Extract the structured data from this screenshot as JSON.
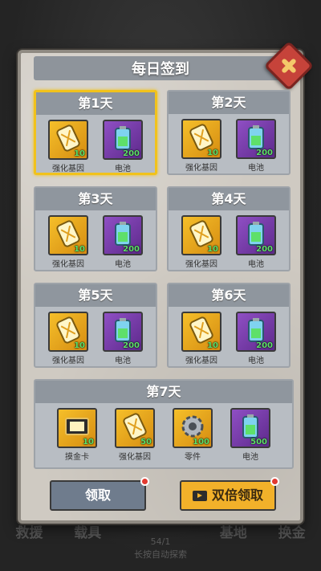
{
  "background": {
    "nav": [
      "救援",
      "载具",
      "基地",
      "换金"
    ],
    "center_count": "54/1",
    "center_hint": "长按自动探索"
  },
  "dialog": {
    "title": "每日签到",
    "days": [
      {
        "label": "第1天",
        "highlight": true,
        "rewards": [
          {
            "name": "强化基因",
            "qty": "10",
            "icon": "gene-icon",
            "color": "gold"
          },
          {
            "name": "电池",
            "qty": "200",
            "icon": "battery-icon",
            "color": "purple"
          }
        ]
      },
      {
        "label": "第2天",
        "highlight": false,
        "rewards": [
          {
            "name": "强化基因",
            "qty": "10",
            "icon": "gene-icon",
            "color": "gold"
          },
          {
            "name": "电池",
            "qty": "200",
            "icon": "battery-icon",
            "color": "purple"
          }
        ]
      },
      {
        "label": "第3天",
        "highlight": false,
        "rewards": [
          {
            "name": "强化基因",
            "qty": "10",
            "icon": "gene-icon",
            "color": "gold"
          },
          {
            "name": "电池",
            "qty": "200",
            "icon": "battery-icon",
            "color": "purple"
          }
        ]
      },
      {
        "label": "第4天",
        "highlight": false,
        "rewards": [
          {
            "name": "强化基因",
            "qty": "10",
            "icon": "gene-icon",
            "color": "gold"
          },
          {
            "name": "电池",
            "qty": "200",
            "icon": "battery-icon",
            "color": "purple"
          }
        ]
      },
      {
        "label": "第5天",
        "highlight": false,
        "rewards": [
          {
            "name": "强化基因",
            "qty": "10",
            "icon": "gene-icon",
            "color": "gold"
          },
          {
            "name": "电池",
            "qty": "200",
            "icon": "battery-icon",
            "color": "purple"
          }
        ]
      },
      {
        "label": "第6天",
        "highlight": false,
        "rewards": [
          {
            "name": "强化基因",
            "qty": "10",
            "icon": "gene-icon",
            "color": "gold"
          },
          {
            "name": "电池",
            "qty": "200",
            "icon": "battery-icon",
            "color": "purple"
          }
        ]
      }
    ],
    "day7": {
      "label": "第7天",
      "rewards": [
        {
          "name": "摸金卡",
          "qty": "10",
          "icon": "card-icon",
          "color": "gold"
        },
        {
          "name": "强化基因",
          "qty": "50",
          "icon": "gene-icon",
          "color": "gold"
        },
        {
          "name": "零件",
          "qty": "100",
          "icon": "gear-icon",
          "color": "gold"
        },
        {
          "name": "电池",
          "qty": "500",
          "icon": "battery-icon",
          "color": "purple"
        }
      ]
    },
    "buttons": {
      "claim": "领取",
      "double": "双倍领取"
    }
  }
}
